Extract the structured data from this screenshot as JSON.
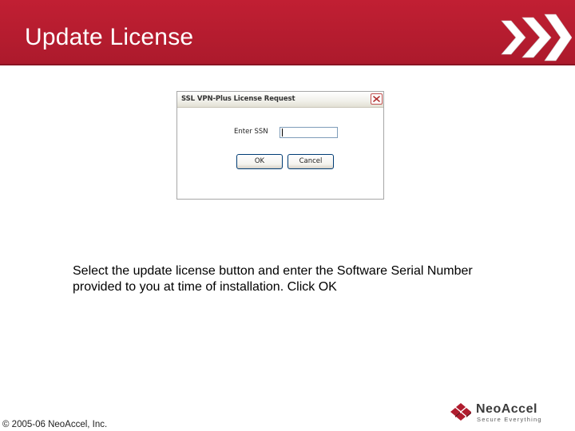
{
  "slide": {
    "title": "Update License",
    "caption_lines": [
      "Select the update license button and enter the Software Serial Number",
      "provided to you at time of installation. Click OK"
    ]
  },
  "dialog": {
    "title": "SSL VPN-Plus License Request",
    "ssn_label": "Enter SSN",
    "ssn_value": "",
    "ok_label": "OK",
    "cancel_label": "Cancel",
    "close_icon": "close-icon"
  },
  "footer": {
    "copyright": "© 2005-06 NeoAccel, Inc.",
    "logo_name": "NeoAccel",
    "logo_tagline": "Secure Everything"
  },
  "colors": {
    "header_red": "#b01c2e",
    "logo_red": "#b01c2e"
  },
  "icons": {
    "header_decoration": "triple-chevron-icon",
    "logo": "neoaccel-logo-icon"
  }
}
